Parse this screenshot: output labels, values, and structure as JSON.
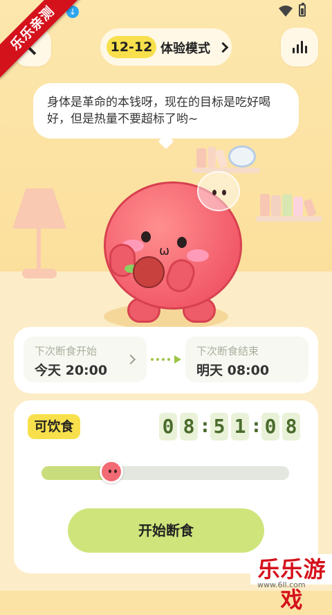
{
  "watermark": {
    "top_left": "乐乐亲测",
    "bottom_right": "乐乐游戏",
    "url": "www.6ll.com"
  },
  "header": {
    "date": "12-12",
    "mode_label": "体验模式"
  },
  "speech": {
    "text": "身体是革命的本钱呀，现在的目标是吃好喝好，但是热量不要超标了哟~"
  },
  "schedule": {
    "start": {
      "title": "下次断食开始",
      "value": "今天 20:00"
    },
    "end": {
      "title": "下次断食结束",
      "value": "明天 08:00"
    }
  },
  "timer": {
    "status": "可饮食",
    "digits": [
      "0",
      "8",
      "5",
      "1",
      "0",
      "8"
    ],
    "separators": [
      ":",
      ":"
    ],
    "progress_fraction": 0.26
  },
  "action": {
    "start_label": "开始断食"
  },
  "colors": {
    "accent_yellow": "#f8e04c",
    "accent_green": "#cfe57b",
    "character_pink": "#f25b6a"
  },
  "icons": {
    "back": "chevron-left-icon",
    "stats": "bar-chart-icon",
    "mode_more": "chevron-right-icon"
  }
}
